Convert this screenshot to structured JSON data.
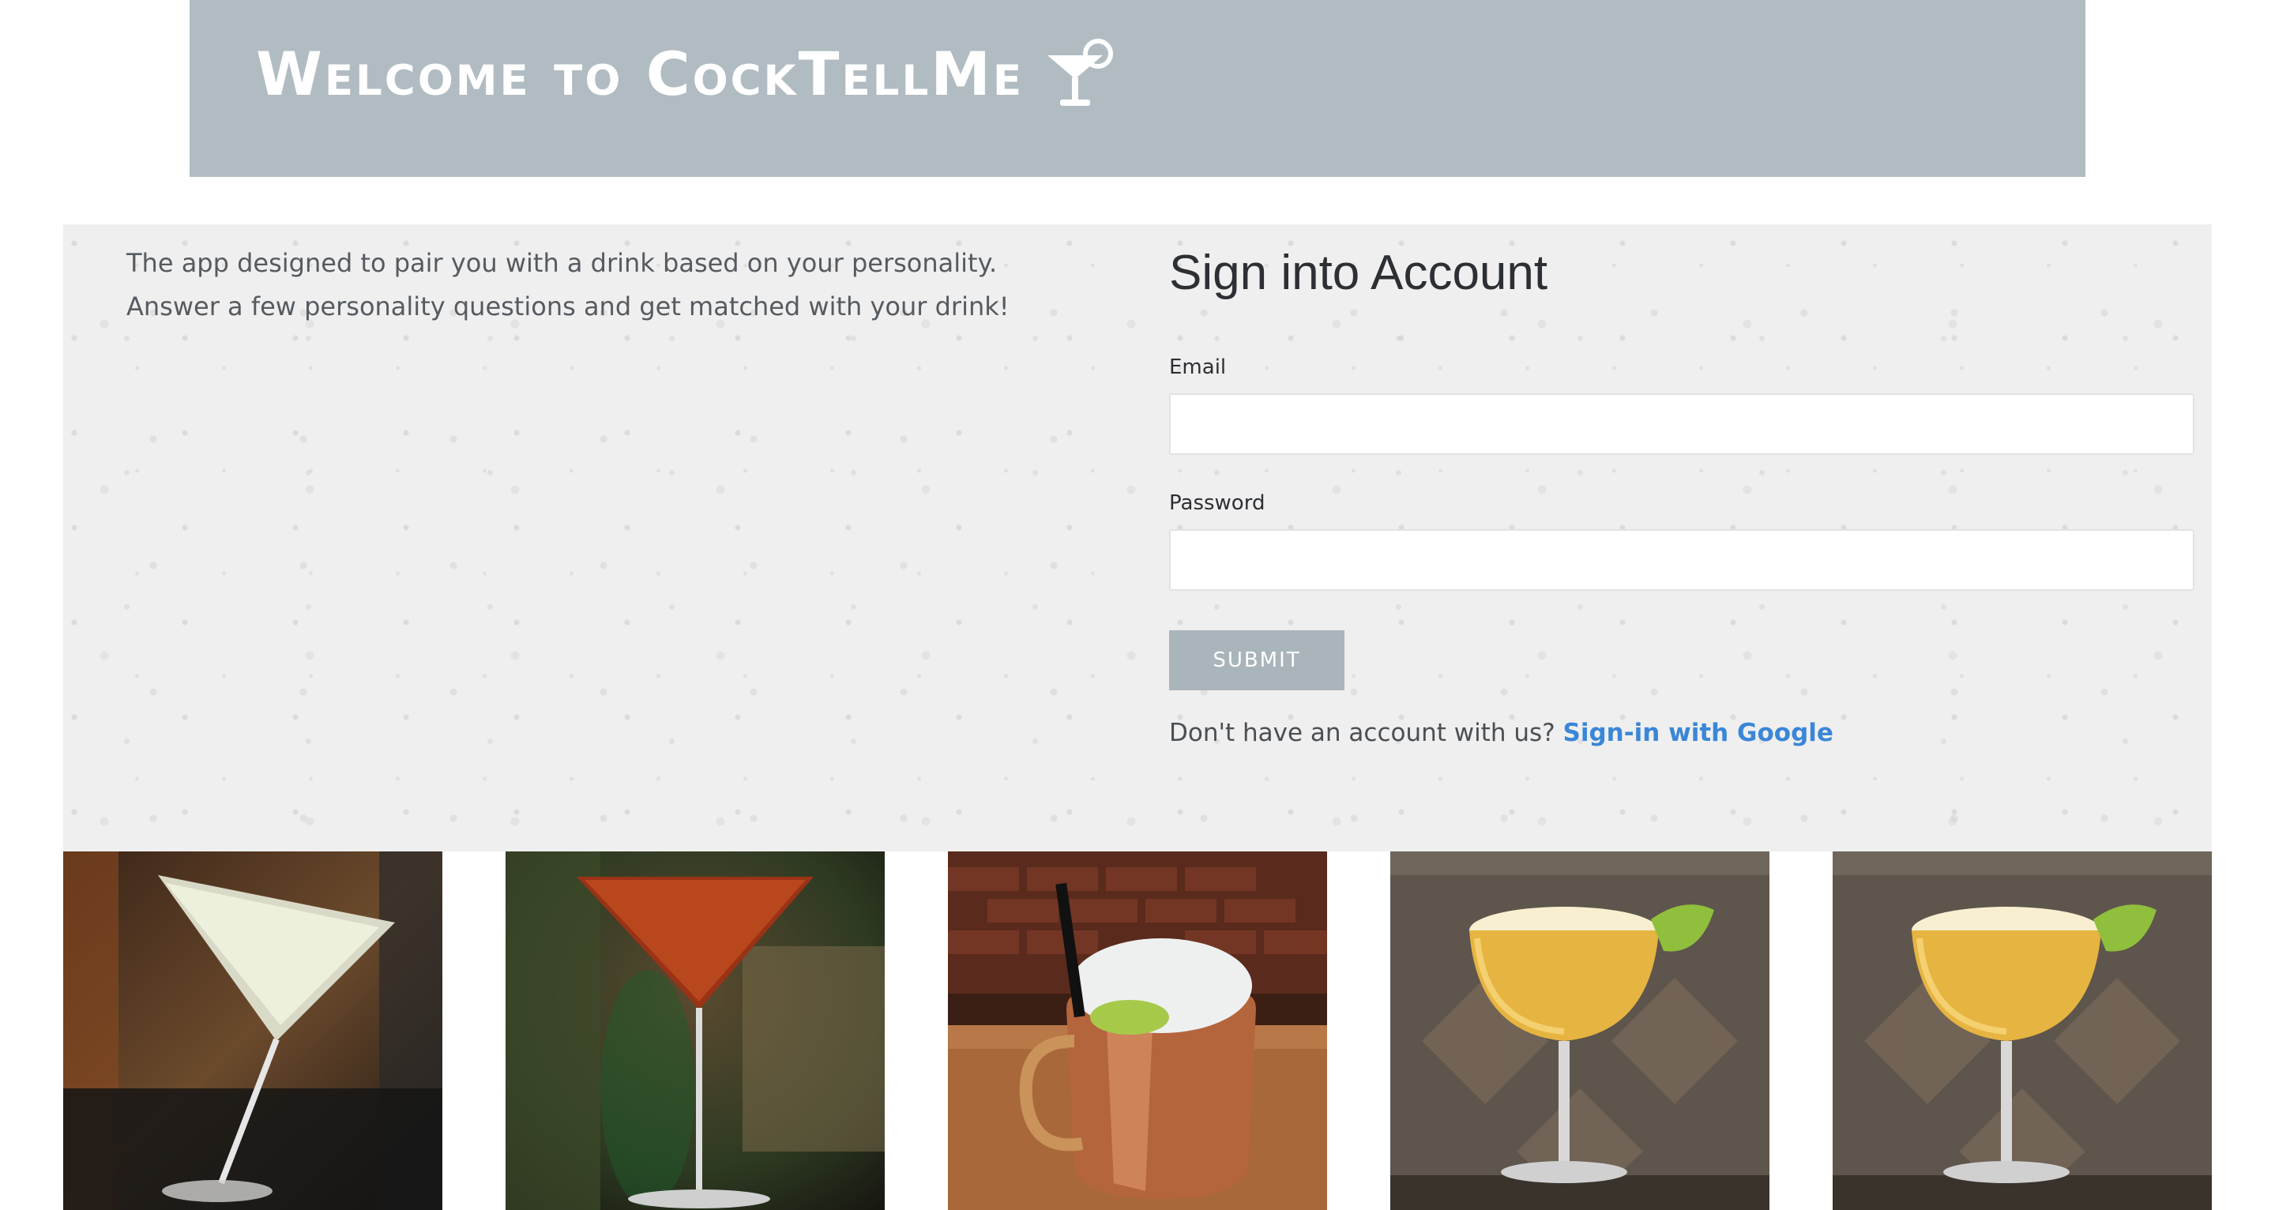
{
  "header": {
    "title": "Welcome to CockTellMe",
    "logo_icon": "cocktail-glass-icon"
  },
  "intro": {
    "line1": "The app designed to pair you with a drink based on your personality.",
    "line2": "Answer a few personality questions and get matched with your drink!"
  },
  "signin": {
    "heading": "Sign into Account",
    "email_label": "Email",
    "email_value": "",
    "password_label": "Password",
    "password_value": "",
    "submit_label": "SUBMIT",
    "no_account_text": "Don't have an account with us?",
    "google_link": "Sign-in with Google"
  },
  "gallery": {
    "photos": [
      {
        "subject": "martini-glass-white"
      },
      {
        "subject": "martini-glass-red"
      },
      {
        "subject": "copper-mule-mug"
      },
      {
        "subject": "coupe-glass-yellow-lime"
      },
      {
        "subject": "coupe-glass-yellow-lime"
      }
    ]
  },
  "colors": {
    "banner": "#b1bcc2",
    "panel": "#efefef",
    "button": "#a9b5bb",
    "link": "#3a86d8"
  }
}
